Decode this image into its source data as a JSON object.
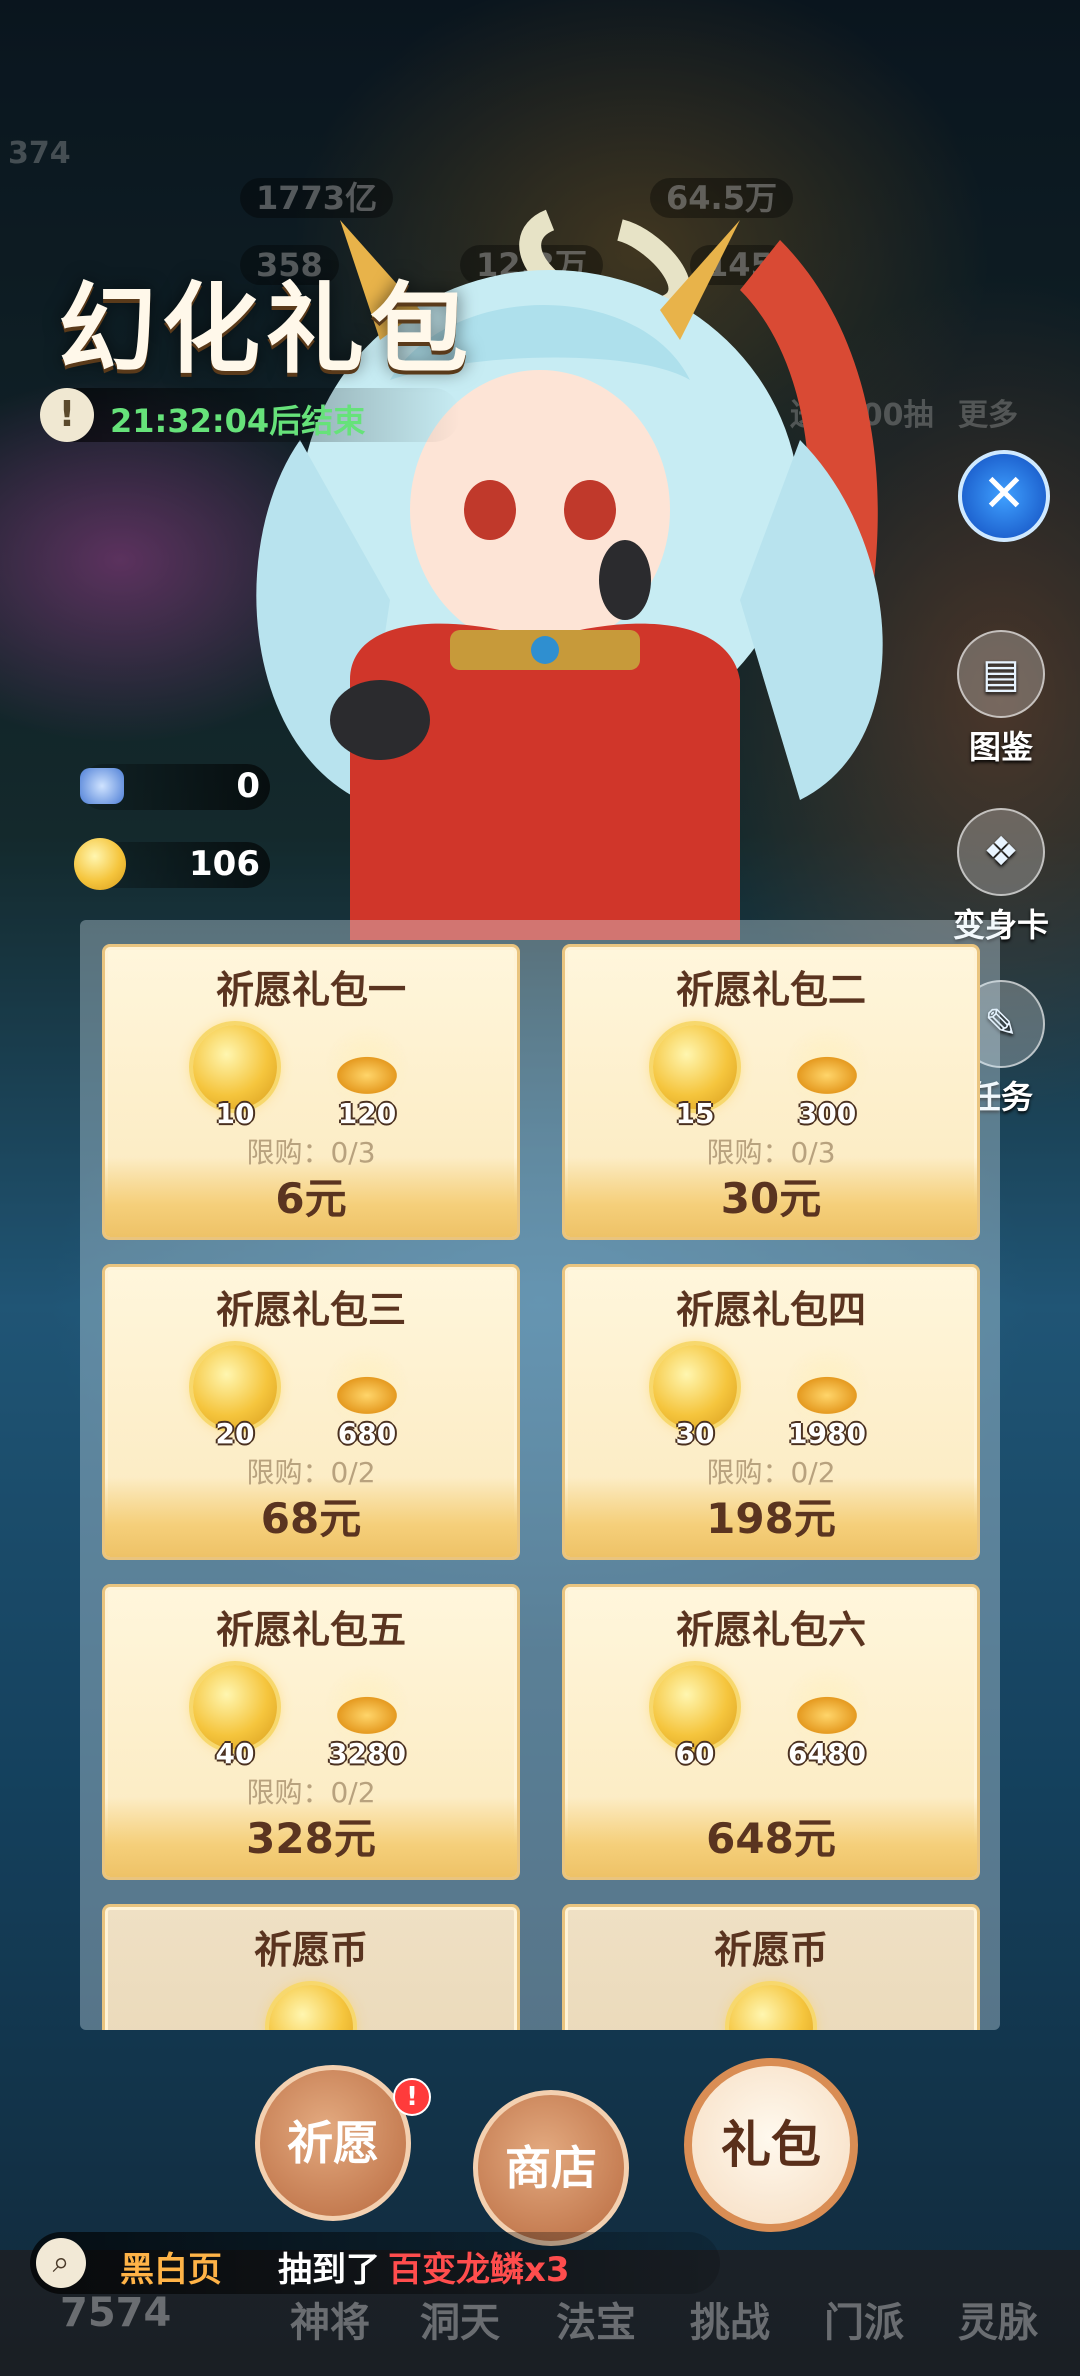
{
  "hud": {
    "level": "374",
    "stat1": "1773亿",
    "stat2": "64.5万",
    "stat3": "358",
    "stat4": "12.3万",
    "stat5": "145",
    "promo": "送1000抽",
    "more": "更多"
  },
  "header": {
    "title": "幻化礼包",
    "countdown": "21:32:04后结束"
  },
  "side_buttons": [
    {
      "label": "图鉴",
      "icon": "book-icon"
    },
    {
      "label": "变身卡",
      "icon": "card-icon"
    },
    {
      "label": "任务",
      "icon": "scroll-icon"
    }
  ],
  "currency": [
    {
      "icon": "ticket-icon",
      "value": "0"
    },
    {
      "icon": "wish-coin-icon",
      "value": "106"
    }
  ],
  "packs": [
    {
      "name": "祈愿礼包一",
      "coin_qty": "10",
      "ingot_qty": "120",
      "limit": "限购：0/3",
      "price": "6元"
    },
    {
      "name": "祈愿礼包二",
      "coin_qty": "15",
      "ingot_qty": "300",
      "limit": "限购：0/3",
      "price": "30元"
    },
    {
      "name": "祈愿礼包三",
      "coin_qty": "20",
      "ingot_qty": "680",
      "limit": "限购：0/2",
      "price": "68元"
    },
    {
      "name": "祈愿礼包四",
      "coin_qty": "30",
      "ingot_qty": "1980",
      "limit": "限购：0/2",
      "price": "198元"
    },
    {
      "name": "祈愿礼包五",
      "coin_qty": "40",
      "ingot_qty": "3280",
      "limit": "限购：0/2",
      "price": "328元"
    },
    {
      "name": "祈愿礼包六",
      "coin_qty": "60",
      "ingot_qty": "6480",
      "limit": "",
      "price": "648元"
    },
    {
      "name": "祈愿币"
    },
    {
      "name": "祈愿币"
    }
  ],
  "tabs": {
    "wish": "祈愿",
    "wish_badge": "!",
    "shop": "商店",
    "gift": "礼包"
  },
  "broadcast": {
    "user": "黑白页",
    "action": "抽到了",
    "item": "百变龙鳞x3"
  },
  "nav": {
    "power": "7574",
    "items": [
      "神将",
      "洞天",
      "法宝",
      "挑战",
      "门派",
      "灵脉"
    ]
  },
  "colors": {
    "timer_green": "#66e27a",
    "price_brown": "#5a3420",
    "broadcast_user": "#ffb347",
    "broadcast_item": "#ff4d4d",
    "card_bg": "#fbe9bd"
  }
}
